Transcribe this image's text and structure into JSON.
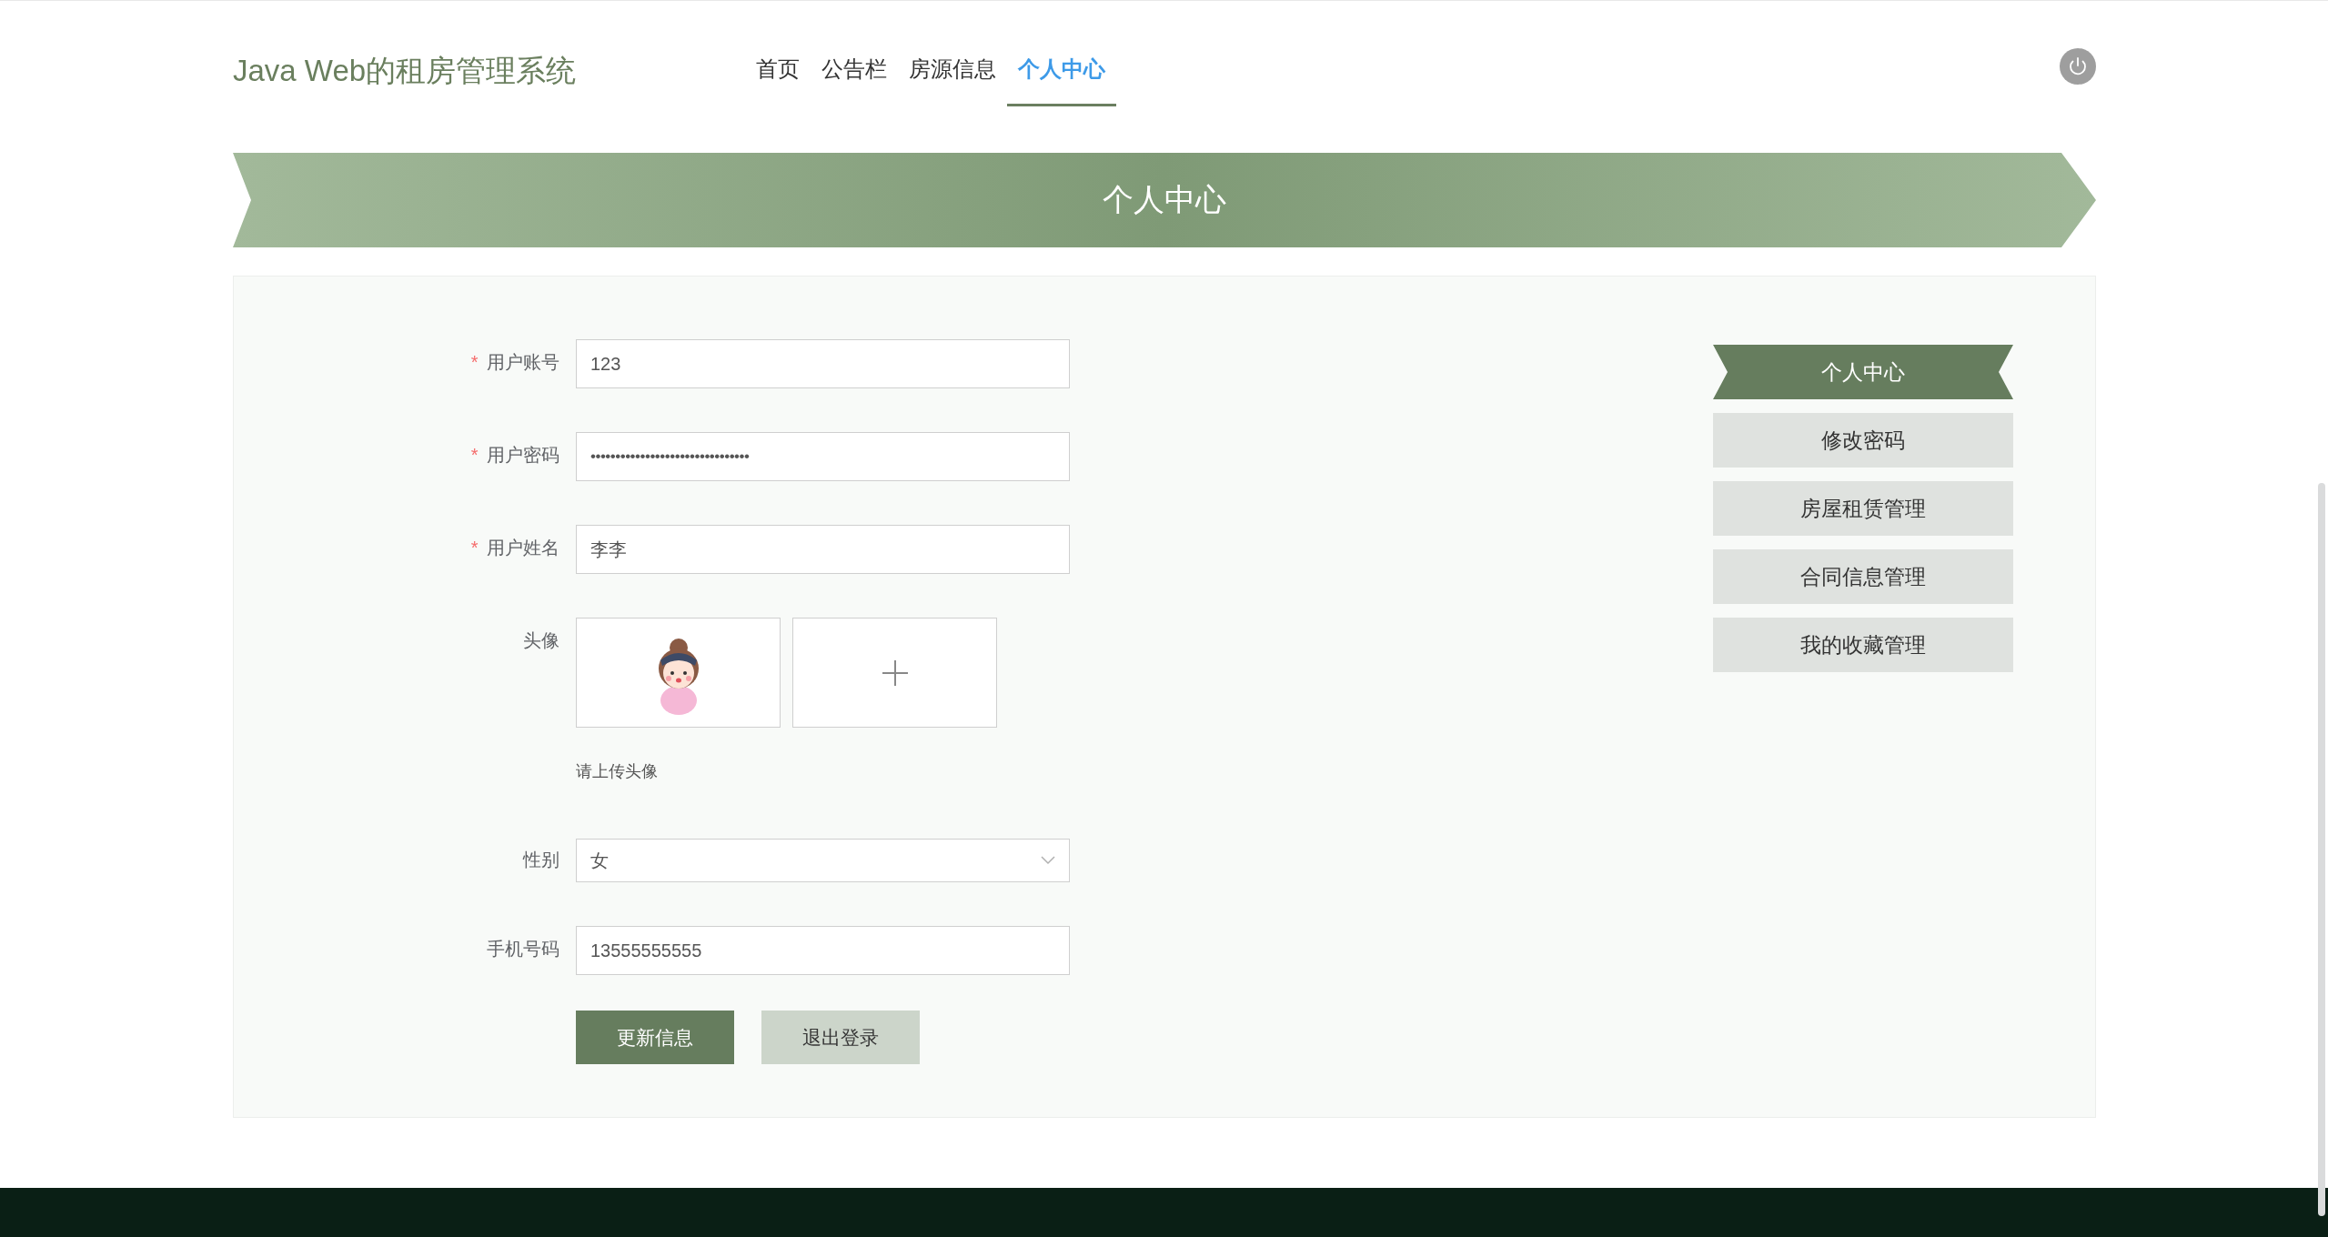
{
  "site_title": "Java Web的租房管理系统",
  "nav": [
    {
      "label": "首页",
      "selected": false
    },
    {
      "label": "公告栏",
      "selected": false
    },
    {
      "label": "房源信息",
      "selected": false
    },
    {
      "label": "个人中心",
      "selected": true
    }
  ],
  "banner": {
    "title": "个人中心"
  },
  "form": {
    "fields": [
      {
        "kind": "text",
        "required_mark": "*",
        "label": "用户账号",
        "value": "123"
      },
      {
        "kind": "password",
        "required_mark": "*",
        "label": "用户密码",
        "value": "••••••••••••••••••••••••••••••••"
      },
      {
        "kind": "text",
        "required_mark": "*",
        "label": "用户姓名",
        "value": "李李"
      },
      {
        "kind": "image",
        "label": "头像",
        "hint": "请上传头像"
      },
      {
        "kind": "select",
        "label": "性别",
        "value": "女"
      },
      {
        "kind": "text",
        "label": "手机号码",
        "value": "13555555555"
      }
    ],
    "buttons": [
      {
        "label": "更新信息",
        "kind": "primary"
      },
      {
        "label": "退出登录",
        "kind": "secondary"
      }
    ]
  },
  "side_menu": [
    {
      "label": "个人中心",
      "selected": true
    },
    {
      "label": "修改密码",
      "selected": false
    },
    {
      "label": "房屋租赁管理",
      "selected": false
    },
    {
      "label": "合同信息管理",
      "selected": false
    },
    {
      "label": "我的收藏管理",
      "selected": false
    }
  ]
}
